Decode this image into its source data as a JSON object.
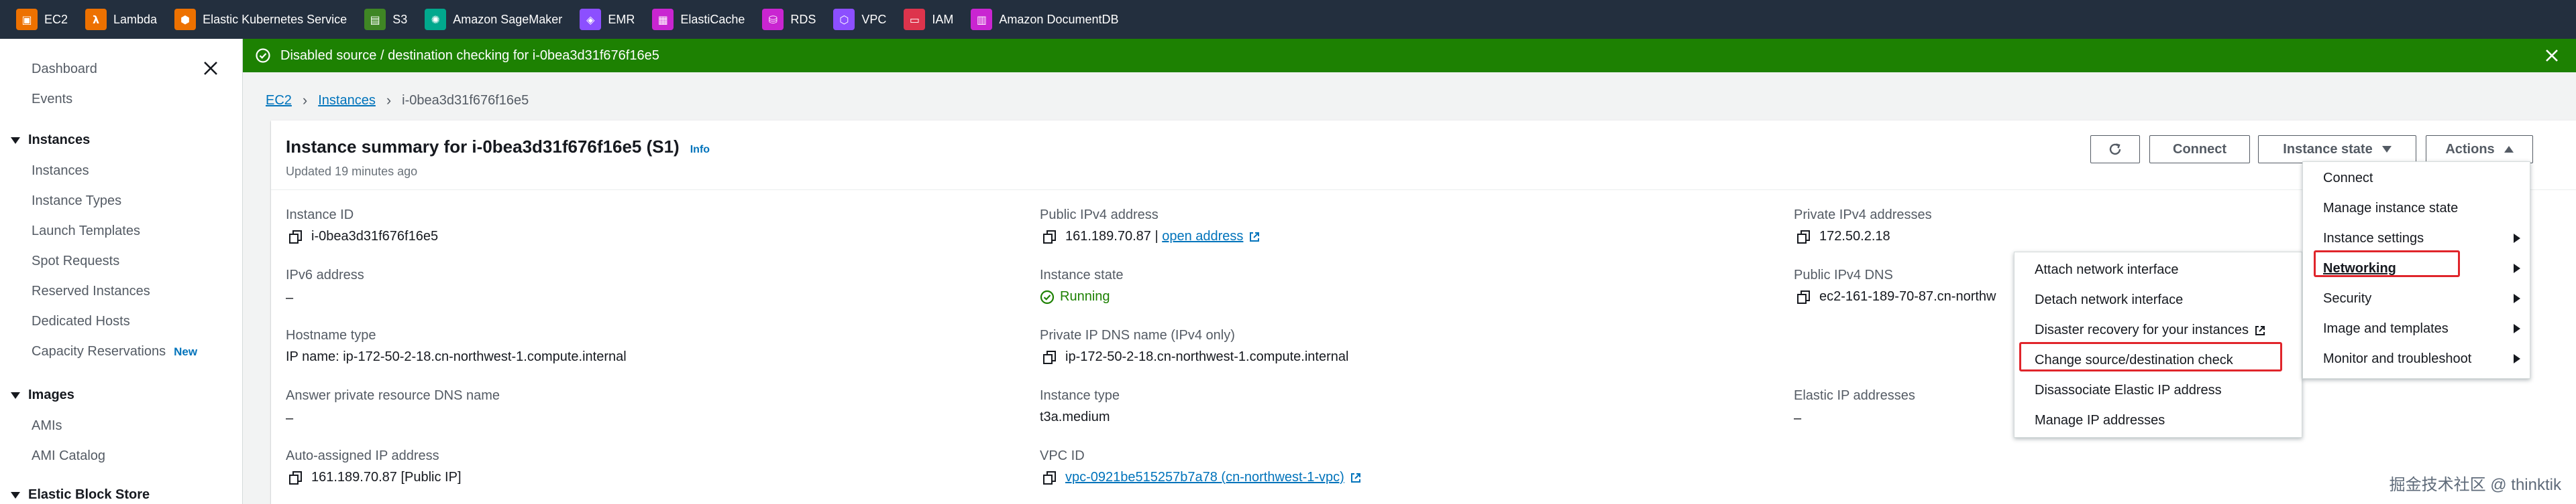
{
  "services": [
    {
      "label": "EC2",
      "icon": "ec2-icon",
      "color": "#ed7100",
      "glyph": "▣"
    },
    {
      "label": "Lambda",
      "icon": "lambda-icon",
      "color": "#ed7100",
      "glyph": "λ"
    },
    {
      "label": "Elastic Kubernetes Service",
      "icon": "eks-icon",
      "color": "#ed7100",
      "glyph": "⬢"
    },
    {
      "label": "S3",
      "icon": "s3-icon",
      "color": "#3f8624",
      "glyph": "▤"
    },
    {
      "label": "Amazon SageMaker",
      "icon": "sagemaker-icon",
      "color": "#01a88d",
      "glyph": "✺"
    },
    {
      "label": "EMR",
      "icon": "emr-icon",
      "color": "#8c4fff",
      "glyph": "◈"
    },
    {
      "label": "ElastiCache",
      "icon": "elasticache-icon",
      "color": "#c925d1",
      "glyph": "▦"
    },
    {
      "label": "RDS",
      "icon": "rds-icon",
      "color": "#c925d1",
      "glyph": "⛁"
    },
    {
      "label": "VPC",
      "icon": "vpc-icon",
      "color": "#8c4fff",
      "glyph": "⬡"
    },
    {
      "label": "IAM",
      "icon": "iam-icon",
      "color": "#dd344c",
      "glyph": "▭"
    },
    {
      "label": "Amazon DocumentDB",
      "icon": "documentdb-icon",
      "color": "#c925d1",
      "glyph": "▥"
    }
  ],
  "sidebar": {
    "dashboard": "Dashboard",
    "events": "Events",
    "instances_header": "Instances",
    "instances_items": [
      "Instances",
      "Instance Types",
      "Launch Templates",
      "Spot Requests",
      "Reserved Instances",
      "Dedicated Hosts",
      "Capacity Reservations"
    ],
    "new_badge": "New",
    "images_header": "Images",
    "images_items": [
      "AMIs",
      "AMI Catalog"
    ],
    "ebs_header": "Elastic Block Store"
  },
  "flash": {
    "message": "Disabled source / destination checking for i-0bea3d31f676f16e5",
    "color": "#1d8102"
  },
  "breadcrumb": {
    "ec2": "EC2",
    "instances": "Instances",
    "current": "i-0bea3d31f676f16e5"
  },
  "summary": {
    "title": "Instance summary for i-0bea3d31f676f16e5 (S1)",
    "info": "Info",
    "updated": "Updated 19 minutes ago",
    "buttons": {
      "connect": "Connect",
      "instance_state": "Instance state",
      "actions": "Actions"
    }
  },
  "details": {
    "instance_id_label": "Instance ID",
    "instance_id": "i-0bea3d31f676f16e5",
    "ipv6_label": "IPv6 address",
    "ipv6": "–",
    "hostname_type_label": "Hostname type",
    "hostname_type": "IP name: ip-172-50-2-18.cn-northwest-1.compute.internal",
    "answer_dns_label": "Answer private resource DNS name",
    "answer_dns": "–",
    "auto_ip_label": "Auto-assigned IP address",
    "auto_ip": "161.189.70.87 [Public IP]",
    "public_ipv4_label": "Public IPv4 address",
    "public_ipv4": "161.189.70.87 |",
    "open_address": "open address",
    "instance_state_label": "Instance state",
    "instance_state": "Running",
    "private_dns_label": "Private IP DNS name (IPv4 only)",
    "private_dns": "ip-172-50-2-18.cn-northwest-1.compute.internal",
    "instance_type_label": "Instance type",
    "instance_type": "t3a.medium",
    "vpc_label": "VPC ID",
    "vpc": "vpc-0921be515257b7a78 (cn-northwest-1-vpc)",
    "private_ipv4_label": "Private IPv4 addresses",
    "private_ipv4": "172.50.2.18",
    "public_dns_label": "Public IPv4 DNS",
    "public_dns": "ec2-161-189-70-87.cn-northw",
    "elastic_ip_label": "Elastic IP addresses",
    "elastic_ip": "–"
  },
  "actions_menu": [
    "Connect",
    "Manage instance state",
    "Instance settings",
    "Networking",
    "Security",
    "Image and templates",
    "Monitor and troubleshoot"
  ],
  "networking_menu": [
    "Attach network interface",
    "Detach network interface",
    "Disaster recovery for your instances",
    "Change source/destination check",
    "Disassociate Elastic IP address",
    "Manage IP addresses"
  ],
  "watermark": "掘金技术社区 @ thinktik",
  "colors": {
    "link": "#0073bb",
    "highlight": "#e0252b",
    "nav": "#232f3e"
  }
}
